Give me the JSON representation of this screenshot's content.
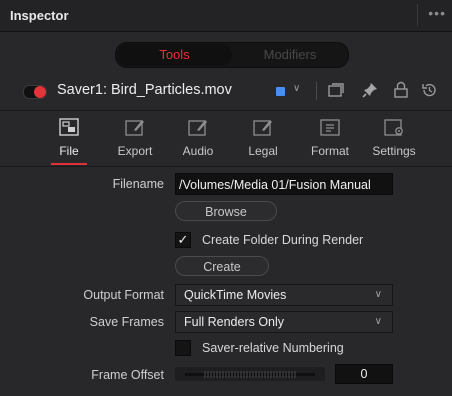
{
  "window": {
    "title": "Inspector",
    "menu_glyph": "•••"
  },
  "segmented": {
    "tools": "Tools",
    "modifiers": "Modifiers"
  },
  "node": {
    "name": "Saver1: Bird_Particles.mov",
    "color_chip": "#4d8cf0",
    "enabled": true
  },
  "tabs": [
    {
      "label": "File",
      "icon": "file-tab-icon",
      "active": true
    },
    {
      "label": "Export",
      "icon": "export-tab-icon",
      "active": false
    },
    {
      "label": "Audio",
      "icon": "audio-tab-icon",
      "active": false
    },
    {
      "label": "Legal",
      "icon": "legal-tab-icon",
      "active": false
    },
    {
      "label": "Format",
      "icon": "format-tab-icon",
      "active": false
    },
    {
      "label": "Settings",
      "icon": "settings-tab-icon",
      "active": false
    }
  ],
  "form": {
    "filename_label": "Filename",
    "filename_value": "/Volumes/Media 01/Fusion Manual",
    "browse_button": "Browse",
    "create_folder_label": "Create Folder During Render",
    "create_folder_checked": true,
    "create_button": "Create",
    "output_format_label": "Output Format",
    "output_format_value": "QuickTime Movies",
    "save_frames_label": "Save Frames",
    "save_frames_value": "Full Renders Only",
    "saver_relative_label": "Saver-relative Numbering",
    "saver_relative_checked": false,
    "frame_offset_label": "Frame Offset",
    "frame_offset_value": "0"
  },
  "colors": {
    "accent_red": "#e1303a",
    "panel_bg": "#28282b"
  }
}
